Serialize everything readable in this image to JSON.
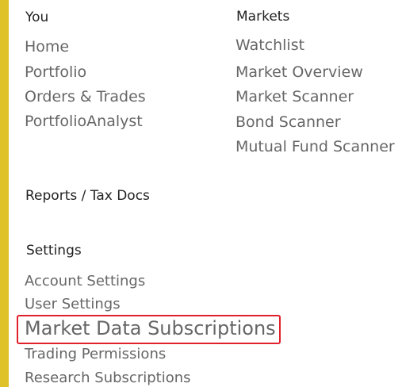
{
  "colors": {
    "accent_bar": "#dfc12a",
    "highlight_border": "#e0202a",
    "heading_text": "#222222",
    "link_text": "#666666"
  },
  "you": {
    "heading": "You",
    "items": [
      "Home",
      "Portfolio",
      "Orders & Trades",
      "PortfolioAnalyst"
    ]
  },
  "markets": {
    "heading": "Markets",
    "items": [
      "Watchlist",
      "Market Overview",
      "Market Scanner",
      "Bond Scanner",
      "Mutual Fund Scanner"
    ]
  },
  "reports": {
    "heading": "Reports / Tax Docs"
  },
  "settings": {
    "heading": "Settings",
    "items": [
      "Account Settings",
      "User Settings",
      "Market Data Subscriptions",
      "Trading Permissions",
      "Research Subscriptions"
    ],
    "highlighted_item": "Market Data Subscriptions"
  }
}
